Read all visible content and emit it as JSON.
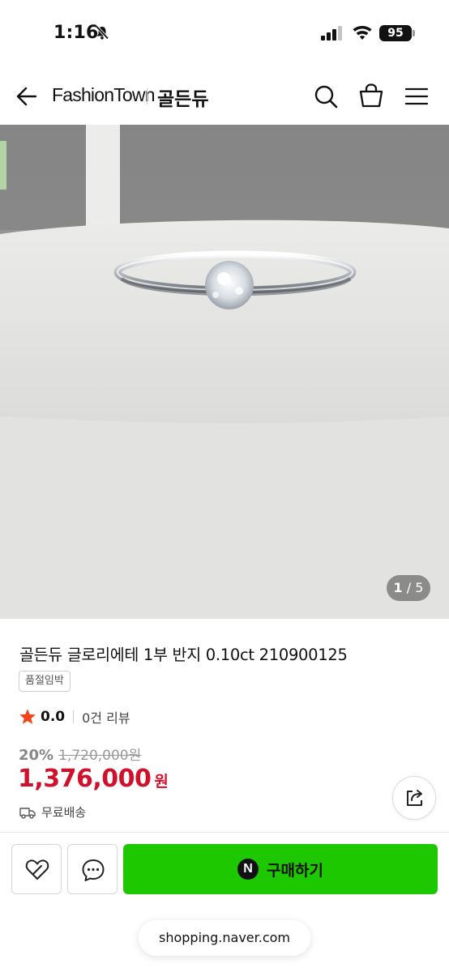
{
  "status_bar": {
    "time": "1:16",
    "battery": "95"
  },
  "header": {
    "brand": "FashionTown",
    "store": "골든듀"
  },
  "gallery": {
    "current": "1",
    "separator": " / ",
    "total": "5"
  },
  "product": {
    "title": "골든듀 글로리에테 1부 반지 0.10ct 210900125",
    "badge": "품절임박",
    "rating": "0.0",
    "reviews": "0건 리뷰",
    "discount": "20%",
    "original_price": "1,720,000원",
    "sale_price": "1,376,000",
    "currency": "원",
    "shipping": "무료배송"
  },
  "actions": {
    "buy_label": "구매하기",
    "naver_letter": "N"
  },
  "browser": {
    "url": "shopping.naver.com"
  },
  "colors": {
    "accent_green": "#1ec800",
    "price_red": "#d1102c",
    "star_red": "#f2421b"
  }
}
